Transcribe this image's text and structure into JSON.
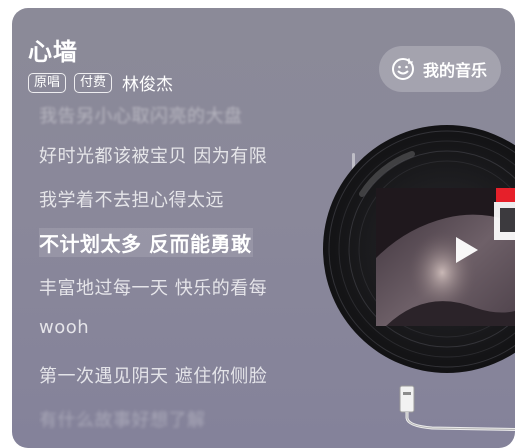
{
  "song": {
    "title": "心墙",
    "artist": "林俊杰",
    "tags": [
      "原唱",
      "付费"
    ]
  },
  "header": {
    "my_music_label": "我的音乐",
    "my_music_icon": "smile-music-icon"
  },
  "lyrics": {
    "lines": [
      {
        "text": "我告另小心取闪亮的大盘",
        "state": "faded"
      },
      {
        "text": "好时光都该被宝贝 因为有限",
        "state": "normal"
      },
      {
        "text": "我学着不去担心得太远",
        "state": "normal"
      },
      {
        "text": "不计划太多 反而能勇敢",
        "state": "current"
      },
      {
        "text": "丰富地过每一天 快乐的看每",
        "state": "normal"
      },
      {
        "text": "wooh",
        "state": "normal"
      },
      {
        "text": "第一次遇见阴天 遮住你侧脸",
        "state": "normal"
      },
      {
        "text": "有什么故事好想了解",
        "state": "bottom-faded"
      }
    ]
  },
  "player": {
    "disc_icon": "vinyl-record",
    "play_icon": "play-icon",
    "accent_color": "#e6202a"
  }
}
